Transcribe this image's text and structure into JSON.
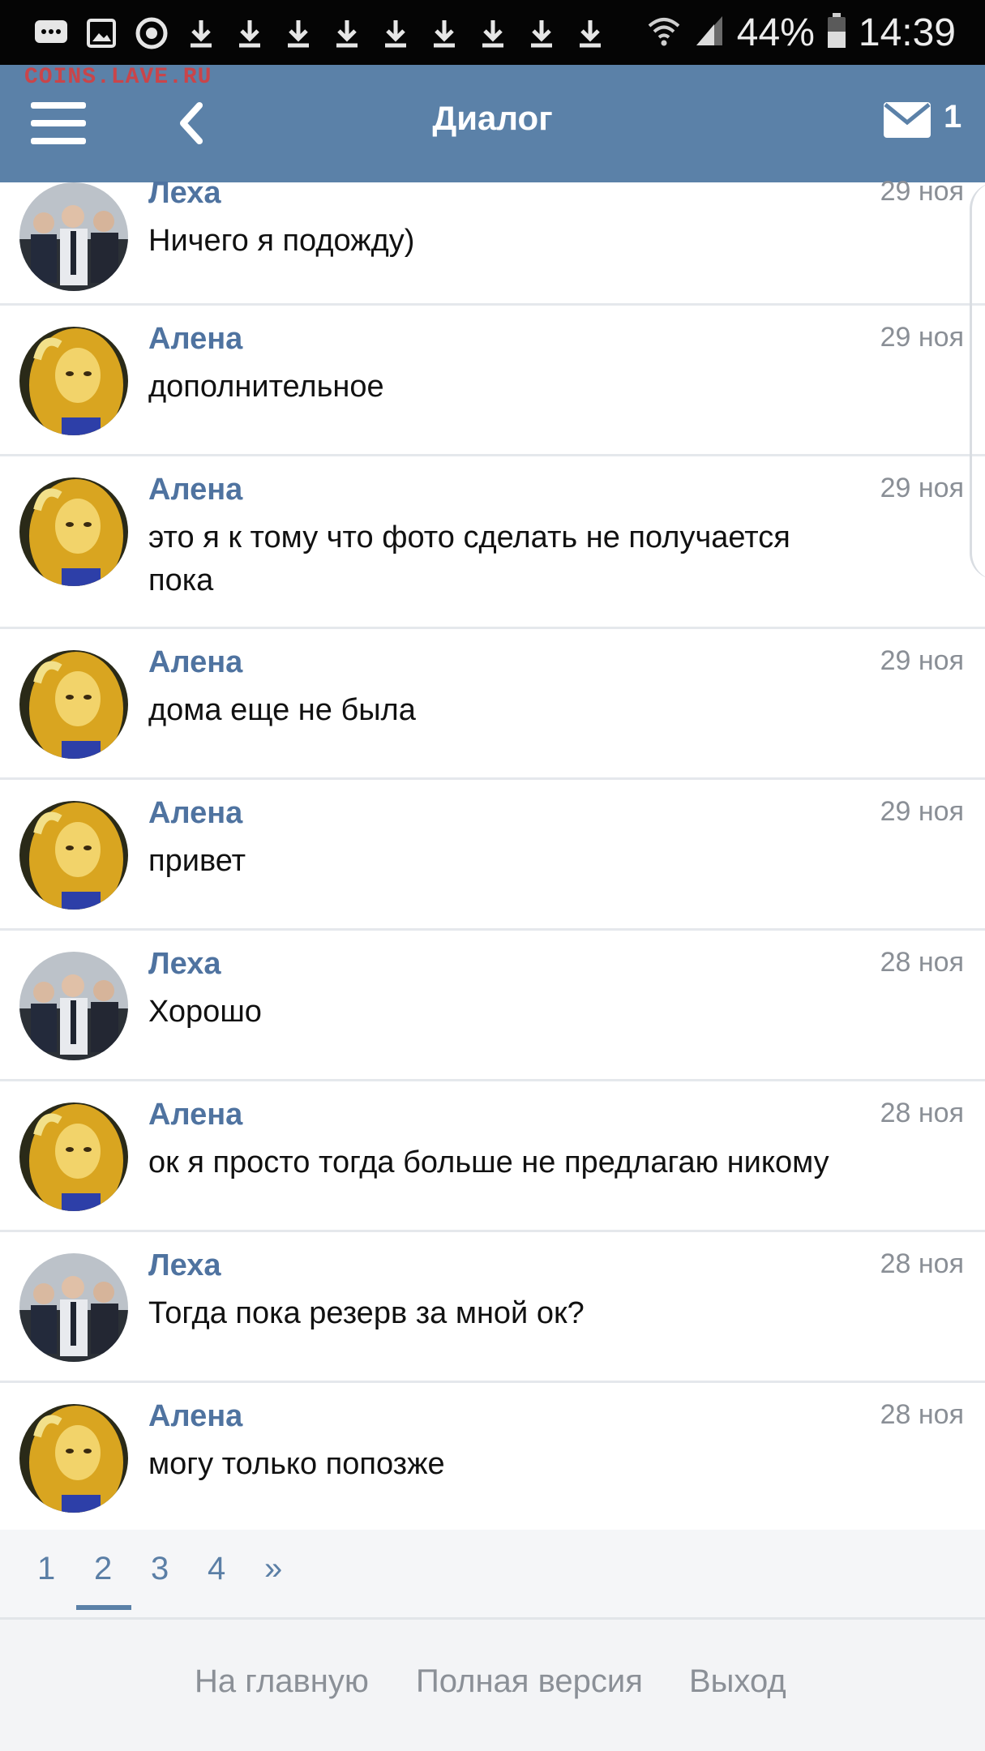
{
  "status_bar": {
    "battery": "44%",
    "time": "14:39"
  },
  "watermark": "COINS.LAVE.RU",
  "header": {
    "title": "Диалог",
    "unread_count": "1"
  },
  "messages": [
    {
      "author": "Леха",
      "date": "29 ноя",
      "text": "Ничего я подожду)"
    },
    {
      "author": "Алена",
      "date": "29 ноя",
      "text": "дополнительное"
    },
    {
      "author": "Алена",
      "date": "29 ноя",
      "text": "это я к тому что фото сделать не получается пока"
    },
    {
      "author": "Алена",
      "date": "29 ноя",
      "text": "дома еще не была"
    },
    {
      "author": "Алена",
      "date": "29 ноя",
      "text": "привет"
    },
    {
      "author": "Леха",
      "date": "28 ноя",
      "text": "Хорошо"
    },
    {
      "author": "Алена",
      "date": "28 ноя",
      "text": "ок я просто тогда больше не предлагаю никому"
    },
    {
      "author": "Леха",
      "date": "28 ноя",
      "text": "Тогда пока резерв за мной ок?"
    },
    {
      "author": "Алена",
      "date": "28 ноя",
      "text": "могу только попозже"
    }
  ],
  "pagination": {
    "pages": [
      "1",
      "2",
      "3",
      "4"
    ],
    "next": "»",
    "current": "2"
  },
  "footer": {
    "home": "На главную",
    "full_version": "Полная версия",
    "logout": "Выход"
  },
  "colors": {
    "header": "#5b81a8",
    "author": "#4f73a0",
    "date": "#8a8f96",
    "watermark": "#c9454a"
  }
}
